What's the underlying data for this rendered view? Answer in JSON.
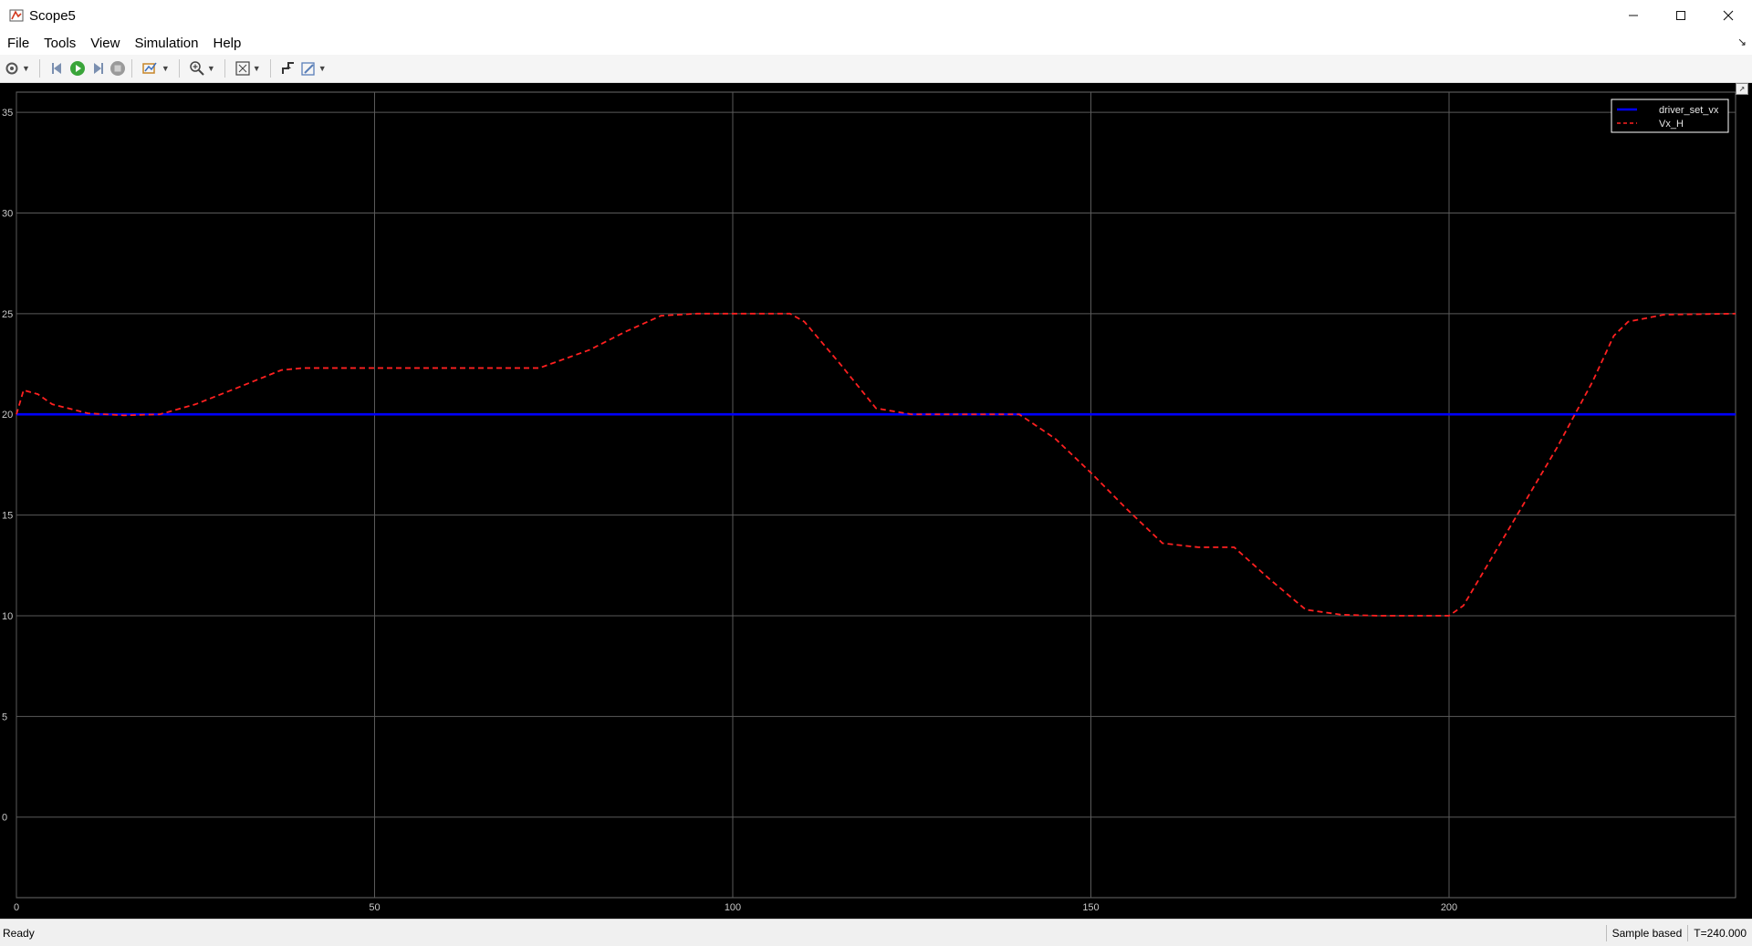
{
  "window": {
    "title": "Scope5",
    "icon": "matlab-scope-icon",
    "controls": [
      "minimize-icon",
      "maximize-icon",
      "close-icon"
    ]
  },
  "menu": {
    "items": [
      {
        "label": "File"
      },
      {
        "label": "Tools"
      },
      {
        "label": "View"
      },
      {
        "label": "Simulation"
      },
      {
        "label": "Help"
      }
    ]
  },
  "toolbar": {
    "buttons": [
      "settings-icon",
      "step-back-icon",
      "run-icon",
      "step-forward-icon",
      "stop-icon",
      "highlight-icon",
      "zoom-in-icon",
      "fit-to-view-icon",
      "triggers-icon",
      "style-icon"
    ]
  },
  "colors": {
    "plot_bg": "#000000",
    "grid": "#5a5a5a",
    "series1": "#0000ff",
    "series2": "#ff2020"
  },
  "chart_data": {
    "type": "line",
    "title": "",
    "xlabel": "",
    "ylabel": "",
    "xlim": [
      0,
      240
    ],
    "ylim": [
      -4,
      36
    ],
    "xticks": [
      0,
      50,
      100,
      150,
      200
    ],
    "yticks": [
      0,
      5,
      10,
      15,
      20,
      25,
      30,
      35
    ],
    "grid": true,
    "legend_position": "top-right",
    "series": [
      {
        "name": "driver_set_vx",
        "color": "#0000ff",
        "style": "solid",
        "x": [
          0,
          240
        ],
        "y": [
          20,
          20
        ]
      },
      {
        "name": "Vx_H",
        "color": "#ff2020",
        "style": "dashed",
        "x": [
          0,
          1,
          3,
          5,
          10,
          15,
          20,
          25,
          30,
          37,
          40,
          50,
          60,
          70,
          73,
          80,
          85,
          90,
          95,
          100,
          108,
          110,
          115,
          120,
          125,
          130,
          140,
          145,
          150,
          155,
          160,
          165,
          170,
          175,
          180,
          185,
          190,
          195,
          200,
          202,
          205,
          210,
          215,
          220,
          223,
          225,
          230,
          240
        ],
        "y": [
          20,
          21.2,
          21,
          20.5,
          20.05,
          19.95,
          20,
          20.5,
          21.2,
          22.2,
          22.3,
          22.3,
          22.3,
          22.3,
          22.3,
          23.2,
          24.1,
          24.9,
          25,
          25,
          25,
          24.6,
          22.5,
          20.3,
          20,
          20,
          20,
          18.8,
          17.1,
          15.3,
          13.6,
          13.4,
          13.4,
          11.8,
          10.3,
          10.05,
          10,
          10,
          10,
          10.5,
          12.3,
          15.3,
          18.3,
          21.6,
          23.9,
          24.6,
          24.95,
          25
        ]
      }
    ]
  },
  "status": {
    "left": "Ready",
    "mode": "Sample based",
    "time": "T=240.000"
  }
}
